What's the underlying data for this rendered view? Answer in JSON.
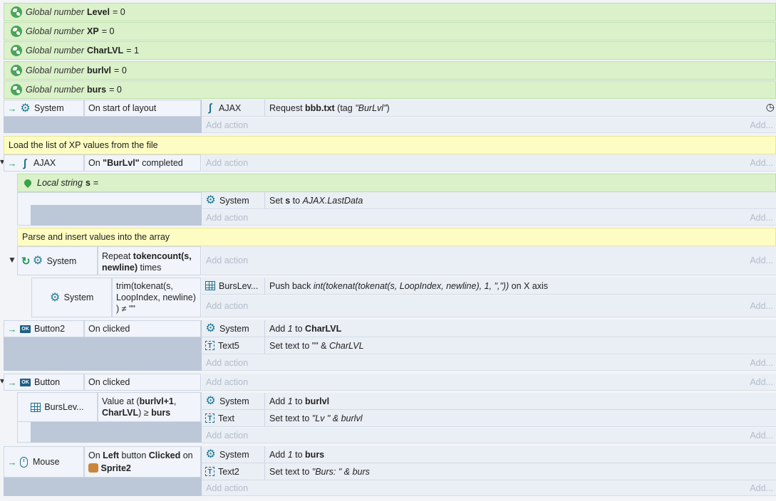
{
  "globals": [
    {
      "prefix": "Global number",
      "name": "Level",
      "value": "= 0"
    },
    {
      "prefix": "Global number",
      "name": "XP",
      "value": "= 0"
    },
    {
      "prefix": "Global number",
      "name": "CharLVL",
      "value": "= 1"
    },
    {
      "prefix": "Global number",
      "name": "burlvl",
      "value": "= 0"
    },
    {
      "prefix": "Global number",
      "name": "burs",
      "value": "= 0"
    }
  ],
  "common": {
    "add_action": "Add action",
    "add": "Add..."
  },
  "event1": {
    "object": "System",
    "condition": "On start of layout",
    "action_object": "AJAX",
    "action_pre": "Request ",
    "action_bold": "bbb.txt",
    "action_mid": " (tag ",
    "action_it": "\"BurLvl\"",
    "action_post": ")"
  },
  "comment1": "Load the list of XP values from the file",
  "event2": {
    "object": "AJAX",
    "cond_pre": "On ",
    "cond_bold": "\"BurLvl\"",
    "cond_post": " completed",
    "local_prefix": "Local string",
    "local_name": "s",
    "local_eq": "=",
    "sub_action_object": "System",
    "sub_action_pre": "Set ",
    "sub_action_bold": "s",
    "sub_action_mid": " to ",
    "sub_action_it": "AJAX.LastData"
  },
  "comment2": "Parse and insert values into the array",
  "event3": {
    "object": "System",
    "cond_pre": "Repeat ",
    "cond_bold": "tokencount(s,",
    "cond_bold2": "newline)",
    "cond_post": " times"
  },
  "event4": {
    "object": "System",
    "cond_line1": "trim(tokenat(s,",
    "cond_line2": "LoopIndex, newline)",
    "cond_line3": ") ≠ \"\"",
    "action_object": "BursLev...",
    "action_pre": "Push back ",
    "action_it": "int(tokenat(tokenat(s, LoopIndex, newline), 1, \",\"))",
    "action_post": " on X axis"
  },
  "event5": {
    "object": "Button2",
    "condition": "On clicked",
    "actions": [
      {
        "object": "System",
        "pre": "Add ",
        "it": "1",
        "mid": " to ",
        "bold": "CharLVL"
      },
      {
        "object": "Text5",
        "pre": "Set text to ",
        "plain": "\"\" & ",
        "it": "CharLVL"
      }
    ]
  },
  "event6": {
    "object": "Button",
    "condition": "On clicked",
    "sub_object": "BursLev...",
    "sub_pre": "Value at (",
    "sub_bold1": "burlvl+1",
    "sub_mid": ",",
    "sub_bold2": "CharLVL",
    "sub_mid2": ") ≥ ",
    "sub_bold3": "burs",
    "actions": [
      {
        "object": "System",
        "pre": "Add ",
        "it": "1",
        "mid": " to ",
        "bold": "burlvl"
      },
      {
        "object": "Text",
        "pre": "Set text to ",
        "it": "\"Lv \" & burlvl"
      }
    ]
  },
  "event7": {
    "object": "Mouse",
    "cond_pre": "On ",
    "cond_bold1": "Left",
    "cond_mid": " button ",
    "cond_bold2": "Clicked",
    "cond_post": " on",
    "cond_target": "Sprite2",
    "actions": [
      {
        "object": "System",
        "pre": "Add ",
        "it": "1",
        "mid": " to ",
        "bold": "burs"
      },
      {
        "object": "Text2",
        "pre": "Set text to ",
        "it": "\"Burs: \" & burs"
      }
    ]
  }
}
